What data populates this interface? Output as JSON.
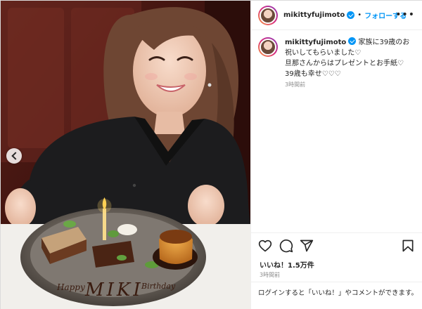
{
  "post": {
    "username": "mikittyfujimoto",
    "follow_label": "フォローする",
    "separator": "•",
    "more_label": "•••",
    "caption": "家族に39歳のお祝いしてもらいました♡\n旦那さんからはプレゼントとお手紙♡\n39歳も幸せ♡♡♡",
    "caption_time": "3時間前",
    "likes": "いいね！1.5万件",
    "post_time": "3時間前",
    "login_prompt": "ログインすると「いいね！」やコメントができます。"
  },
  "photo": {
    "plate_text": "MIKI",
    "plate_text_left": "Happy",
    "plate_text_right": "Birthday"
  },
  "icons": {
    "like": "heart-icon",
    "comment": "comment-icon",
    "share": "paper-plane-icon",
    "save": "bookmark-icon",
    "verified": "verified-badge-icon",
    "prev": "chevron-left-icon"
  },
  "colors": {
    "accent": "#0095f6",
    "text": "#262626",
    "muted": "#8e8e8e",
    "border": "#efefef"
  }
}
